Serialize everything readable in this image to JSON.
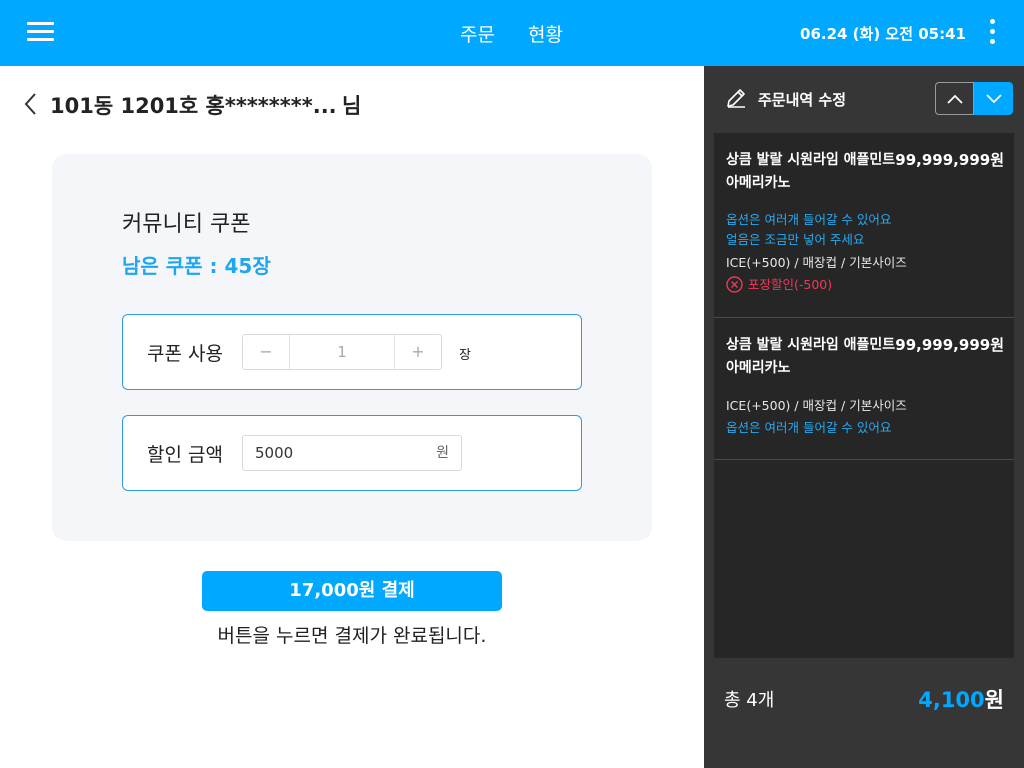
{
  "header": {
    "tabs": [
      "주문",
      "현황"
    ],
    "datetime": "06.24 (화) 오전 05:41"
  },
  "customer": {
    "name": "101동 1201호 홍********...",
    "suffix": "님"
  },
  "coupon": {
    "title": "커뮤니티 쿠폰",
    "remaining": "남은 쿠폰 : 45장",
    "use_label": "쿠폰 사용",
    "quantity": "1",
    "minus": "−",
    "plus": "+",
    "quantity_unit": "장",
    "discount_label": "할인 금액",
    "discount_value": "5000",
    "discount_unit": "원"
  },
  "payment": {
    "button_label": "17,000원 결제",
    "hint": "버튼을 누르면 결제가 완료됩니다."
  },
  "order_panel": {
    "title": "주문내역 수정",
    "items": [
      {
        "name": "상큼 발랄 시원라임 애플민트 아메리카노",
        "price": "99,999,999원",
        "option_note_1": "옵션은 여러개 들어갈 수 있어요",
        "option_note_2": "얼음은 조금만 넣어 주세요",
        "options": "ICE(+500) / 매장컵 / 기본사이즈",
        "discount": "포장할인(-500)"
      },
      {
        "name": "상큼 발랄 시원라임 애플민트 아메리카노",
        "price": "99,999,999원",
        "options": "ICE(+500) / 매장컵 / 기본사이즈",
        "option_note_1": "옵션은 여러개 들어갈 수 있어요"
      }
    ],
    "total_count": "총 4개",
    "total_amount": "4,100",
    "total_unit": "원"
  },
  "colors": {
    "brand": "#00a8ff",
    "accent_text": "#1da7ee",
    "discount": "#f0385a",
    "panel_bg": "#363636"
  }
}
